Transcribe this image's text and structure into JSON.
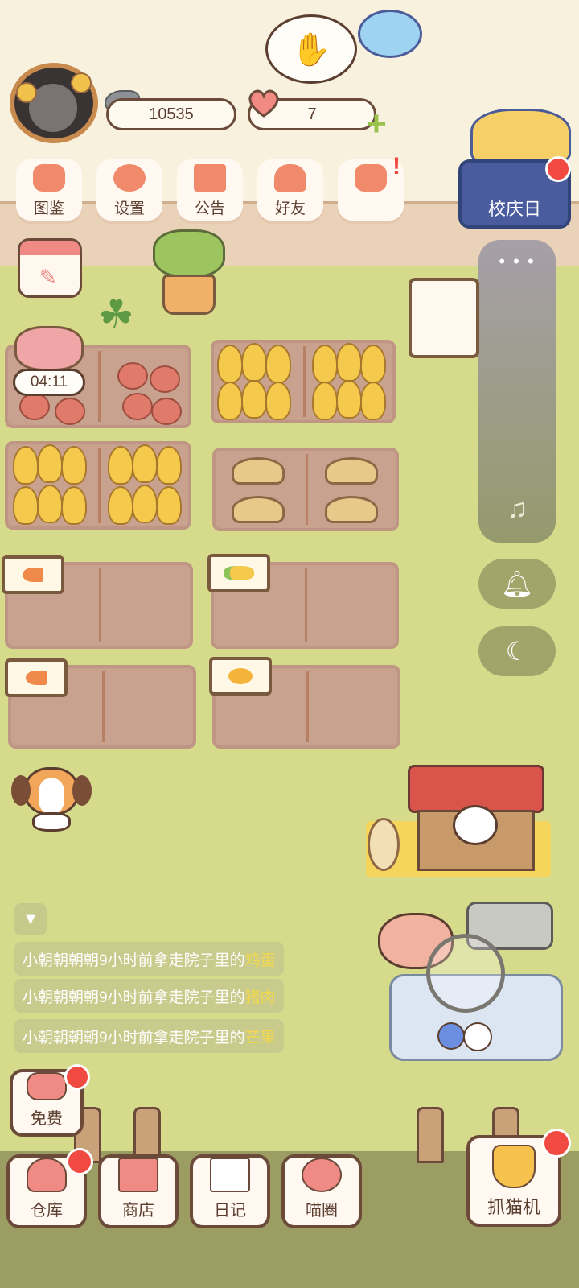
{
  "currency": {
    "fish": "10535",
    "hearts": "7"
  },
  "top_menu": [
    {
      "label": "图鉴",
      "icon": "cat-head-icon"
    },
    {
      "label": "设置",
      "icon": "gear-icon"
    },
    {
      "label": "公告",
      "icon": "gift-icon"
    },
    {
      "label": "好友",
      "icon": "friends-icon"
    },
    {
      "label": "",
      "icon": "heart-mail-icon"
    }
  ],
  "event": {
    "label": "校庆日"
  },
  "plot_timer": "04:11",
  "messages": [
    {
      "prefix": "小朝朝朝朝9小时前拿走院子里的",
      "item": "鸡蛋"
    },
    {
      "prefix": "小朝朝朝朝9小时前拿走院子里的",
      "item": "猪肉"
    },
    {
      "prefix": "小朝朝朝朝9小时前拿走院子里的",
      "item": "芒果"
    }
  ],
  "free_button": {
    "label": "免费"
  },
  "bottom_nav": [
    {
      "label": "仓库",
      "icon": "warehouse-icon"
    },
    {
      "label": "商店",
      "icon": "shop-icon"
    },
    {
      "label": "日记",
      "icon": "diary-icon"
    },
    {
      "label": "喵圈",
      "icon": "cat-planet-icon"
    }
  ],
  "claw_machine": {
    "label": "抓猫机"
  },
  "colors": {
    "lawn": "#d6db8c",
    "badge_red": "#f04a42",
    "highlight_yellow": "#f2d84c"
  }
}
